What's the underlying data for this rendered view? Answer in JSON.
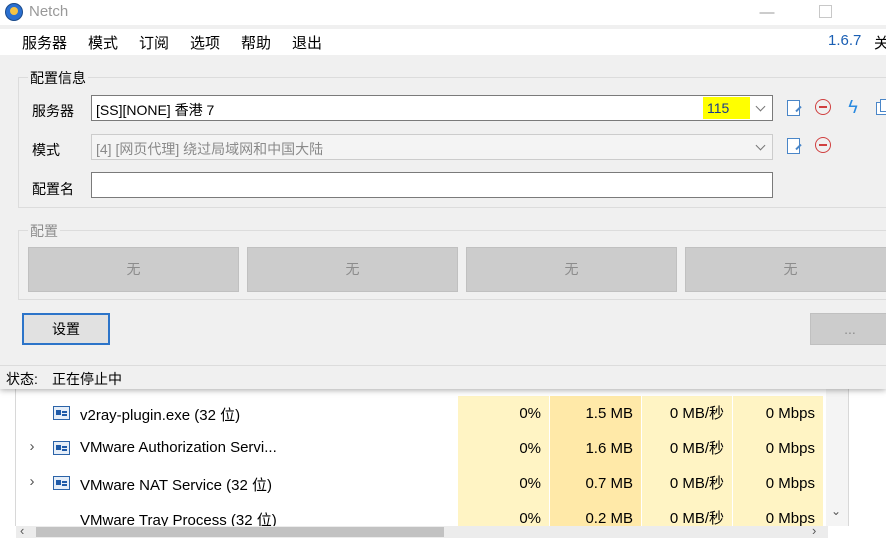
{
  "taskmgr": {
    "rows": [
      {
        "name": "v2ray-plugin.exe (32 位)",
        "expand": "",
        "cpu": "0%",
        "mem": "1.5 MB",
        "disk": "0 MB/秒",
        "net": "0 Mbps"
      },
      {
        "name": "VMware Authorization Servi...",
        "expand": "›",
        "cpu": "0%",
        "mem": "1.6 MB",
        "disk": "0 MB/秒",
        "net": "0 Mbps"
      },
      {
        "name": "VMware NAT Service (32 位)",
        "expand": "›",
        "cpu": "0%",
        "mem": "0.7 MB",
        "disk": "0 MB/秒",
        "net": "0 Mbps"
      },
      {
        "name": "VMware Tray Process (32 位)",
        "expand": "",
        "cpu": "0%",
        "mem": "0.2 MB",
        "disk": "0 MB/秒",
        "net": "0 Mbps"
      }
    ],
    "scroll_down": "⌄",
    "scroll_left": "‹",
    "scroll_right": "›"
  },
  "window": {
    "title": "Netch",
    "minimize": "—",
    "icons": {
      "logo": "netch-logo-icon",
      "maximize": "maximize-icon"
    }
  },
  "menu": {
    "items": [
      "服务器",
      "模式",
      "订阅",
      "选项",
      "帮助",
      "退出"
    ],
    "version": "1.6.7",
    "close": "关"
  },
  "config": {
    "group_title": "配置信息",
    "server_label": "服务器",
    "server_value": "[SS][NONE] 香港 7",
    "latency": "115",
    "mode_label": "模式",
    "mode_value": "[4] [网页代理] 绕过局域网和中国大陆",
    "profile_name_label": "配置名",
    "profile_name_value": ""
  },
  "profiles": {
    "group_title": "配置",
    "buttons": [
      "无",
      "无",
      "无",
      "无"
    ]
  },
  "actions": {
    "settings": "设置",
    "more": "..."
  },
  "status": {
    "label": "状态:",
    "value": "正在停止中"
  },
  "colors": {
    "latency_highlight": "#ffff00",
    "version": "#1a5fb4",
    "accent": "#2c74c9"
  }
}
